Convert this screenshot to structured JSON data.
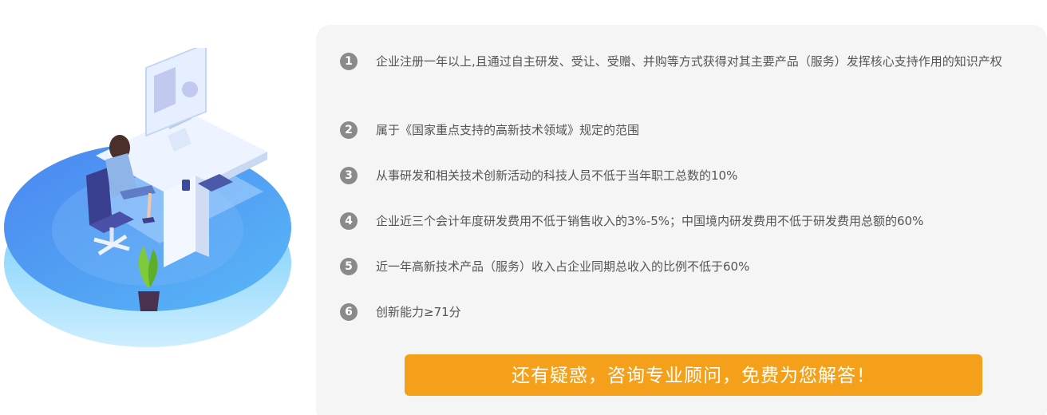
{
  "requirements": [
    {
      "num": "1",
      "text": "企业注册一年以上,且通过自主研发、受让、受赠、并购等方式获得对其主要产品（服务）发挥核心支持作用的知识产权"
    },
    {
      "num": "2",
      "text": "属于《国家重点支持的高新技术领域》规定的范围"
    },
    {
      "num": "3",
      "text": "从事研发和相关技术创新活动的科技人员不低于当年职工总数的10%"
    },
    {
      "num": "4",
      "text": "企业近三个会计年度研发费用不低于销售收入的3%-5%；中国境内研发费用不低于研发费用总额的60%"
    },
    {
      "num": "5",
      "text": "近一年高新技术产品（服务）收入占企业同期总收入的比例不低于60%"
    },
    {
      "num": "6",
      "text": "创新能力≥71分"
    }
  ],
  "cta": {
    "label": "还有疑惑，咨询专业顾问，免费为您解答！"
  },
  "colors": {
    "accent": "#f5a01a",
    "panel": "#f5f5f5",
    "badge": "#8a8a8a",
    "text": "#555555"
  },
  "illustration": {
    "icon": "office-worker-desk-illustration"
  }
}
